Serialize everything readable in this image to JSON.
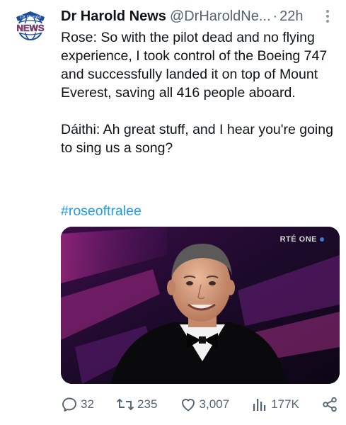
{
  "tweet": {
    "display_name": "Dr Harold News",
    "handle": "@DrHaroldNe...",
    "separator": "·",
    "time": "22h",
    "avatar_text": {
      "top": "Dr Harold",
      "main": "NEWS"
    },
    "paragraphs": [
      "Rose: So with the pilot dead and no flying experience, I took control of the Boeing 747 and successfully landed it on top of Mount Everest, saving all 416 people aboard.",
      "Dáithi: Ah great stuff, and I hear you're going to sing us a song?"
    ],
    "hashtag": "#roseoftralee",
    "media": {
      "watermark": "RTÉ ONE"
    }
  },
  "actions": {
    "replies": "32",
    "retweets": "235",
    "likes": "3,007",
    "views": "177K"
  },
  "icons": [
    "more-icon",
    "reply-icon",
    "retweet-icon",
    "like-icon",
    "views-icon",
    "share-icon"
  ],
  "colors": {
    "link": "#1d9bf0",
    "muted": "#536471",
    "text": "#0f1419"
  }
}
